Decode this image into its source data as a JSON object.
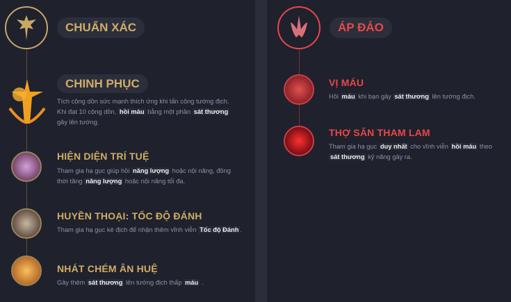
{
  "primary": {
    "name": "CHUẨN XÁC",
    "accent": "#d0ad66",
    "keystone": {
      "name": "CHINH PHỤC",
      "desc": [
        {
          "t": "Tích cộng dồn sức mạnh thích ứng khi tấn công tướng địch. Khi đạt 10 cộng dồn, "
        },
        {
          "t": "hồi máu",
          "b": true
        },
        {
          "t": " bằng một phần "
        },
        {
          "t": "sát thương",
          "b": true
        },
        {
          "t": " gây lên tướng."
        }
      ]
    },
    "runes": [
      {
        "name": "HIỆN DIỆN TRÍ TUỆ",
        "desc": [
          {
            "t": "Tham gia hạ gục giúp hồi "
          },
          {
            "t": "năng lượng",
            "b": true
          },
          {
            "t": " hoặc nội năng, đồng thời tăng "
          },
          {
            "t": "năng lượng",
            "b": true
          },
          {
            "t": " hoặc nội năng tối đa."
          }
        ]
      },
      {
        "name": "HUYỀN THOẠI: TỐC ĐỘ ĐÁNH",
        "desc": [
          {
            "t": "Tham gia hạ gục kẻ địch để nhận thêm vĩnh viễn "
          },
          {
            "t": "Tốc độ Đánh",
            "b": true
          },
          {
            "t": "."
          }
        ]
      },
      {
        "name": "NHÁT CHÉM ÂN HUỆ",
        "desc": [
          {
            "t": "Gây thêm "
          },
          {
            "t": "sát thương",
            "b": true
          },
          {
            "t": " lên tướng địch thấp "
          },
          {
            "t": "máu",
            "b": true
          },
          {
            "t": " ."
          }
        ]
      }
    ]
  },
  "secondary": {
    "name": "ÁP ĐẢO",
    "accent": "#e84848",
    "runes": [
      {
        "name": "VỊ MÁU",
        "desc": [
          {
            "t": "Hồi "
          },
          {
            "t": "máu",
            "b": true
          },
          {
            "t": " khi bạn gây "
          },
          {
            "t": "sát thương",
            "b": true
          },
          {
            "t": " lên tướng địch."
          }
        ]
      },
      {
        "name": "THỢ SĂN THAM LAM",
        "desc": [
          {
            "t": "Tham gia hạ gục "
          },
          {
            "t": "duy nhất",
            "b": true
          },
          {
            "t": " cho vĩnh viễn "
          },
          {
            "t": "hồi máu",
            "b": true
          },
          {
            "t": " theo "
          },
          {
            "t": "sát thương",
            "b": true
          },
          {
            "t": " kỹ năng gây ra."
          }
        ]
      }
    ]
  }
}
